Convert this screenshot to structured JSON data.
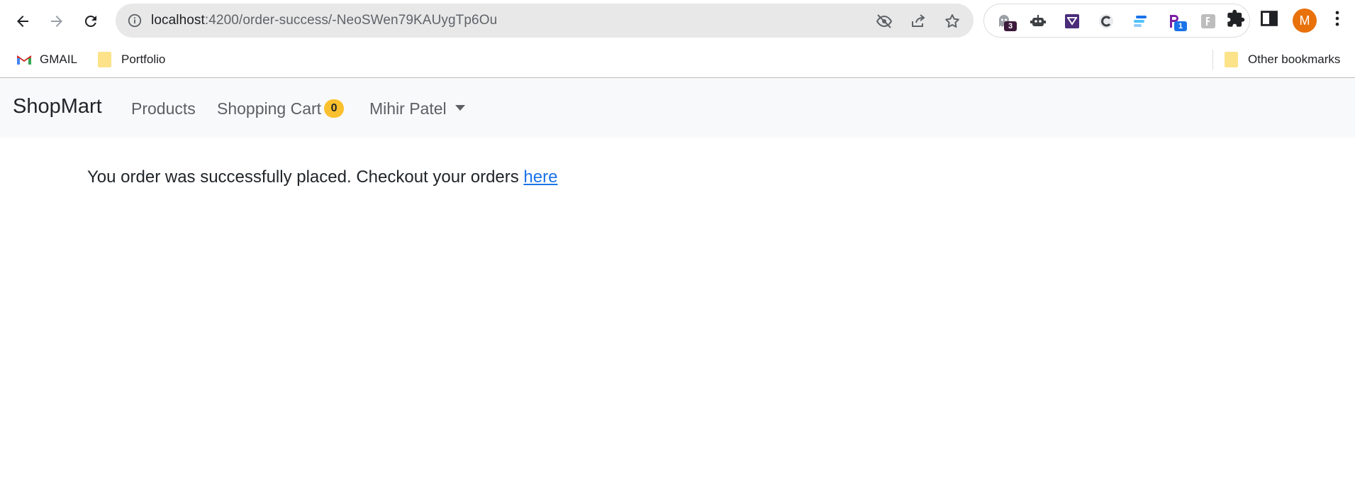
{
  "browser": {
    "url_host": "localhost",
    "url_path": ":4200/order-success/-NeoSWen79KAUygTp6Ou",
    "extensions": [
      {
        "name": "ghost-extension-icon",
        "badge": "3",
        "badge_color": "#3c1a3c"
      },
      {
        "name": "robot-extension-icon"
      },
      {
        "name": "mail-extension-icon"
      },
      {
        "name": "c-extension-icon"
      },
      {
        "name": "bars-extension-icon"
      },
      {
        "name": "p-extension-icon",
        "badge": "1",
        "badge_color": "#1a73e8"
      },
      {
        "name": "stamp-extension-icon"
      }
    ],
    "avatar_letter": "M",
    "avatar_color": "#e8710a"
  },
  "bookmarks": {
    "items": [
      {
        "label": "GMAIL",
        "icon": "gmail-icon"
      },
      {
        "label": "Portfolio",
        "icon": "folder-icon"
      }
    ],
    "other_label": "Other bookmarks"
  },
  "navbar": {
    "brand": "ShopMart",
    "products_label": "Products",
    "cart_label": "Shopping Cart",
    "cart_count": "0",
    "user_label": "Mihir Patel"
  },
  "content": {
    "message": "You order was successfully placed. Checkout your orders ",
    "link_text": "here"
  },
  "colors": {
    "link": "#1a73e8",
    "badge": "#fbc02d",
    "navbar_bg": "#f8f9fa"
  }
}
